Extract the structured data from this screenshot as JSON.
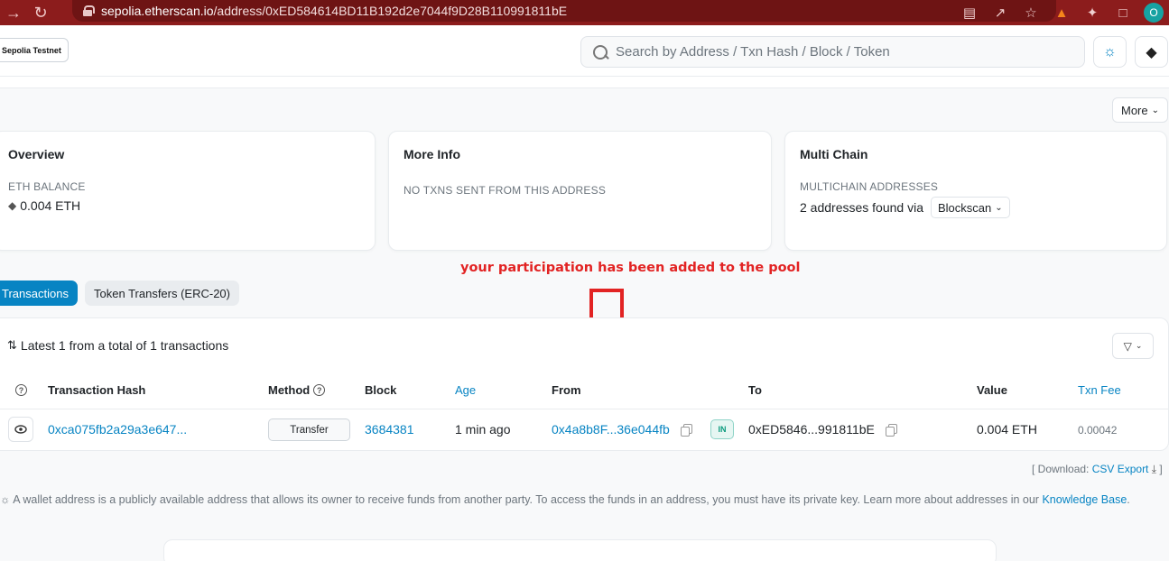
{
  "browser": {
    "url_host": "sepolia.etherscan.io",
    "url_path": "/address/0xED584614BD11B192d2e7044f9D28B110991811bE",
    "profile_initial": "O",
    "colors": {
      "frame": "#8c1c1c",
      "address_bar": "#6e1414"
    },
    "icons": [
      "back-arrow-icon",
      "reload-icon",
      "lock-icon",
      "translate-icon",
      "share-icon",
      "star-icon",
      "metamask-icon",
      "extensions-icon",
      "sidepanel-icon"
    ]
  },
  "header": {
    "network_badge": "Sepolia Testnet",
    "search_placeholder": "Search by Address / Txn Hash / Block / Token",
    "accent": "#0784c3"
  },
  "more_button": "More",
  "cards": {
    "overview": {
      "title": "Overview",
      "balance_label": "ETH BALANCE",
      "balance_value": "0.004 ETH"
    },
    "more_info": {
      "title": "More Info",
      "note": "NO TXNS SENT FROM THIS ADDRESS"
    },
    "multi_chain": {
      "title": "Multi Chain",
      "label": "MULTICHAIN ADDRESSES",
      "value": "2 addresses found via",
      "dropdown": "Blockscan"
    }
  },
  "annotation": {
    "text": "your participation has been added to the pool",
    "color": "#e22323"
  },
  "tabs": [
    {
      "label": "Transactions",
      "active": true
    },
    {
      "label": "Token Transfers (ERC-20)",
      "active": false
    }
  ],
  "transactions": {
    "summary": "Latest 1 from a total of 1 transactions",
    "columns": {
      "hash": "Transaction Hash",
      "method": "Method",
      "block": "Block",
      "age": "Age",
      "from": "From",
      "to": "To",
      "value": "Value",
      "fee": "Txn Fee"
    },
    "rows": [
      {
        "hash": "0xca075fb2a29a3e647...",
        "method": "Transfer",
        "block": "3684381",
        "age": "1 min ago",
        "from": "0x4a8b8F...36e044fb",
        "direction": "IN",
        "to": "0xED5846...991811bE",
        "value": "0.004 ETH",
        "fee": "0.00042"
      }
    ]
  },
  "download": {
    "prefix": "[ Download: ",
    "link": "CSV Export",
    "suffix": " ]"
  },
  "footnote": {
    "text": "A wallet address is a publicly available address that allows its owner to receive funds from another party. To access the funds in an address, you must have its private key. Learn more about addresses in our ",
    "link": "Knowledge Base",
    "end": "."
  }
}
